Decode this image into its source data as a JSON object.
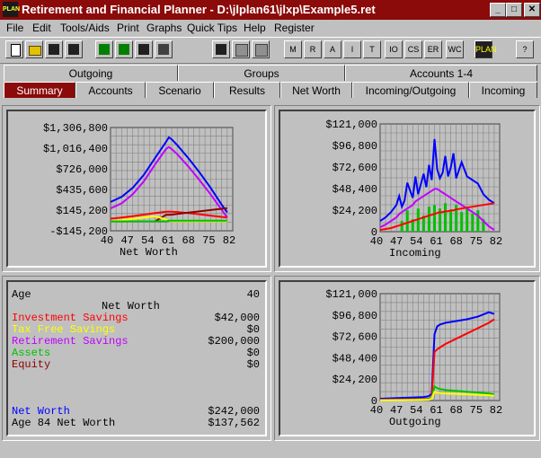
{
  "window": {
    "title": "Retirement and Financial Planner - D:\\jlplan61\\jlxp\\Example5.ret",
    "icon_text": "PLAN"
  },
  "menu": [
    "File",
    "Edit",
    "Tools/Aids",
    "Print",
    "Graphs",
    "Quick Tips",
    "Help",
    "Register"
  ],
  "toolbar": {
    "letter_buttons": [
      "M",
      "R",
      "A",
      "I",
      "T",
      "IO",
      "CS",
      "ER",
      "WC"
    ],
    "plan_label": "PLAN"
  },
  "tabs_top": [
    "Outgoing",
    "Groups",
    "Accounts 1-4"
  ],
  "tabs_bottom": [
    "Summary",
    "Accounts",
    "Scenario",
    "Results",
    "Net Worth",
    "Incoming/Outgoing",
    "Incoming"
  ],
  "active_tab": "Summary",
  "colors": {
    "title_bar": "#8b0a0a",
    "investment": "#ff0000",
    "tax_free": "#ffff00",
    "retirement": "#c000ff",
    "assets": "#00c000",
    "equity": "#8b0000",
    "net_worth": "#0000ff",
    "grid": "#808080"
  },
  "summary": {
    "age_label": "Age",
    "age_value": "40",
    "header": "Net Worth",
    "rows": [
      {
        "label": "Investment Savings",
        "value": "$42,000",
        "color": "#ff0000"
      },
      {
        "label": "Tax Free Savings",
        "value": "$0",
        "color": "#ffff00"
      },
      {
        "label": "Retirement Savings",
        "value": "$200,000",
        "color": "#c000ff"
      },
      {
        "label": "Assets",
        "value": "$0",
        "color": "#00c000"
      },
      {
        "label": "Equity",
        "value": "$0",
        "color": "#8b0000"
      }
    ],
    "net_worth_label": "Net Worth",
    "net_worth_value": "$242,000",
    "age84_label": "Age 84 Net Worth",
    "age84_value": "$137,562"
  },
  "chart_data": [
    {
      "type": "line",
      "title": "Net Worth",
      "x_ticks": [
        "40",
        "47",
        "54",
        "61",
        "68",
        "75",
        "82"
      ],
      "y_ticks": [
        "$1,306,800",
        "$1,016,400",
        "$726,000",
        "$435,600",
        "$145,200",
        "-$145,200"
      ],
      "ylim": [
        -145200,
        1452000
      ],
      "x": [
        40,
        44,
        48,
        52,
        56,
        60,
        61,
        62,
        64,
        68,
        72,
        76,
        80,
        82
      ],
      "series": [
        {
          "color": "#0000ff",
          "values": [
            300000,
            380000,
            520000,
            720000,
            980000,
            1230000,
            1300000,
            1270000,
            1180000,
            980000,
            760000,
            520000,
            260000,
            140000
          ]
        },
        {
          "color": "#c000ff",
          "values": [
            200000,
            280000,
            420000,
            620000,
            880000,
            1120000,
            1150000,
            1120000,
            1040000,
            850000,
            640000,
            420000,
            180000,
            60000
          ]
        },
        {
          "color": "#ff0000",
          "values": [
            42000,
            60000,
            80000,
            105000,
            130000,
            150000,
            152000,
            150000,
            145000,
            130000,
            110000,
            90000,
            70000,
            60000
          ]
        },
        {
          "color": "#8b0000",
          "values": [
            0,
            0,
            0,
            0,
            0,
            100000,
            100000,
            105000,
            115000,
            135000,
            155000,
            175000,
            195000,
            205000
          ]
        },
        {
          "color": "#ffff00",
          "values": [
            0,
            20000,
            40000,
            60000,
            80000,
            30000,
            5000,
            0,
            0,
            0,
            0,
            0,
            0,
            0
          ]
        },
        {
          "color": "#00c000",
          "values": [
            0,
            0,
            0,
            0,
            0,
            0,
            10000,
            10000,
            10000,
            10000,
            10000,
            10000,
            10000,
            10000
          ]
        }
      ]
    },
    {
      "type": "line",
      "title": "Incoming",
      "x_ticks": [
        "40",
        "47",
        "54",
        "61",
        "68",
        "75",
        "82"
      ],
      "y_ticks": [
        "$121,000",
        "$96,800",
        "$72,600",
        "$48,400",
        "$24,200",
        "0"
      ],
      "ylim": [
        0,
        121000
      ],
      "x": [
        40,
        42,
        44,
        46,
        47,
        48,
        49,
        50,
        52,
        53,
        54,
        56,
        57,
        58,
        59,
        60,
        61,
        62,
        63,
        64,
        65,
        66,
        67,
        68,
        70,
        72,
        74,
        76,
        78,
        80,
        82
      ],
      "series": [
        {
          "color": "#0000ff",
          "values": [
            12000,
            16000,
            22000,
            30000,
            40000,
            28000,
            35000,
            55000,
            38000,
            62000,
            42000,
            65000,
            50000,
            75000,
            58000,
            104000,
            70000,
            60000,
            66000,
            85000,
            62000,
            72000,
            88000,
            60000,
            78000,
            62000,
            58000,
            54000,
            42000,
            36000,
            32000
          ]
        },
        {
          "color": "#c000ff",
          "values": [
            5000,
            8000,
            12000,
            16000,
            20000,
            22000,
            24000,
            26000,
            30000,
            34000,
            36000,
            40000,
            42000,
            44000,
            46000,
            48000,
            48000,
            46000,
            44000,
            42000,
            40000,
            38000,
            36000,
            34000,
            30000,
            26000,
            22000,
            18000,
            12000,
            6000,
            2000
          ]
        },
        {
          "color": "#ff0000",
          "values": [
            2000,
            3000,
            4000,
            6000,
            7000,
            8000,
            9000,
            10000,
            12000,
            13000,
            14000,
            16000,
            17000,
            18000,
            19000,
            20000,
            21000,
            22000,
            22000,
            23000,
            23000,
            24000,
            24000,
            25000,
            26000,
            27000,
            28000,
            29000,
            30000,
            31000,
            32000
          ]
        }
      ],
      "bars": {
        "color": "#00c000",
        "x": [
          48,
          50,
          52,
          54,
          56,
          58,
          60,
          62,
          64,
          66,
          68,
          70,
          72,
          74,
          76,
          78
        ],
        "values": [
          12000,
          24000,
          14000,
          26000,
          18000,
          28000,
          30000,
          26000,
          32000,
          24000,
          30000,
          22000,
          28000,
          20000,
          24000,
          14000
        ]
      }
    },
    {
      "type": "line",
      "title": "Outgoing",
      "x_ticks": [
        "40",
        "47",
        "54",
        "61",
        "68",
        "75",
        "82"
      ],
      "y_ticks": [
        "$121,000",
        "$96,800",
        "$72,600",
        "$48,400",
        "$24,200",
        "0"
      ],
      "ylim": [
        0,
        121000
      ],
      "x": [
        40,
        44,
        48,
        52,
        56,
        58,
        59,
        60,
        61,
        62,
        64,
        68,
        72,
        76,
        80,
        82
      ],
      "series": [
        {
          "color": "#0000ff",
          "values": [
            2000,
            2500,
            3000,
            3500,
            4000,
            5000,
            8000,
            75000,
            84000,
            86000,
            88000,
            90000,
            92000,
            95000,
            100000,
            98000
          ]
        },
        {
          "color": "#ff0000",
          "values": [
            1000,
            1200,
            1400,
            1600,
            1800,
            2000,
            3000,
            55000,
            58000,
            60000,
            64000,
            70000,
            76000,
            82000,
            88000,
            92000
          ]
        },
        {
          "color": "#00c000",
          "values": [
            500,
            600,
            800,
            1000,
            1200,
            1500,
            3000,
            16000,
            14000,
            13000,
            12000,
            11000,
            10000,
            9000,
            8000,
            7000
          ]
        },
        {
          "color": "#ffff00",
          "values": [
            300,
            400,
            500,
            600,
            800,
            1000,
            2000,
            10000,
            9000,
            8500,
            8000,
            7500,
            7000,
            6500,
            6000,
            5500
          ]
        }
      ]
    }
  ]
}
